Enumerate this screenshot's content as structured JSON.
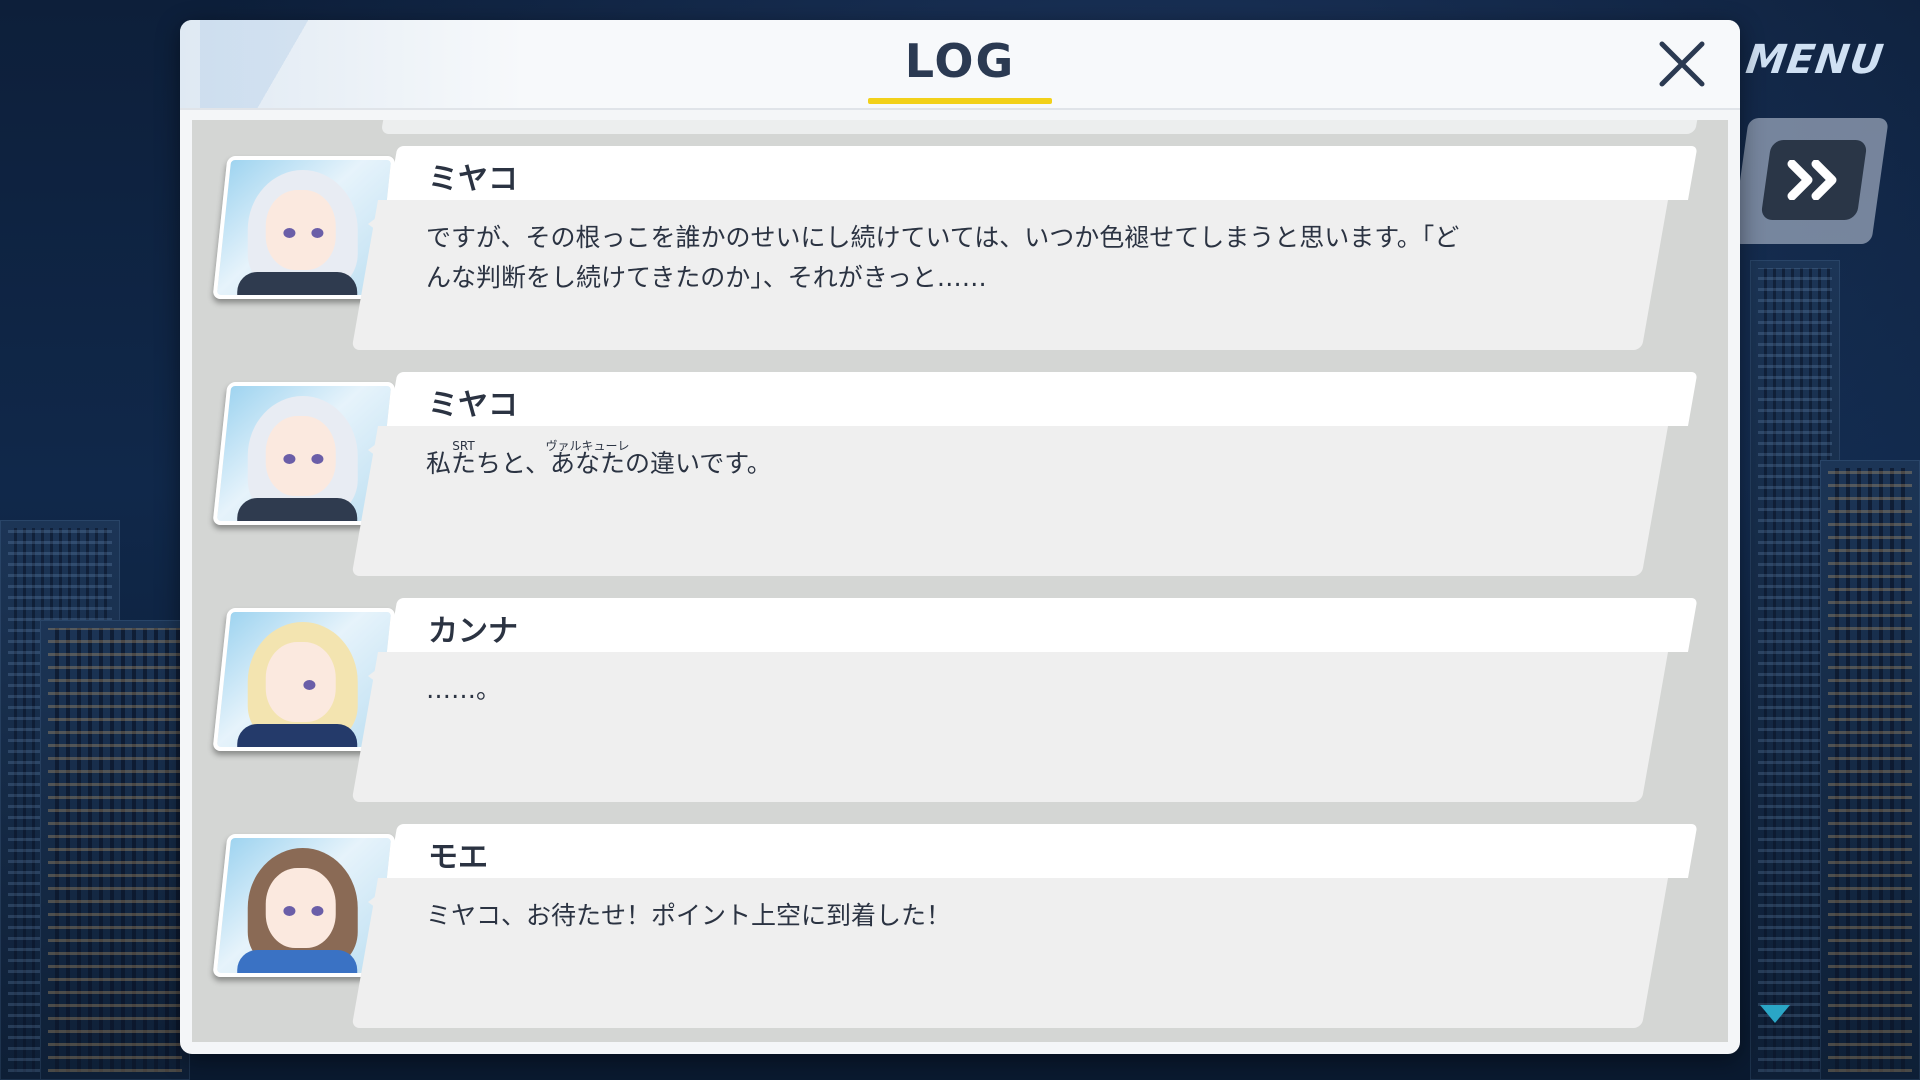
{
  "window": {
    "title": "LOG"
  },
  "controls": {
    "menu_label": "MENU",
    "skip_icon": "double-chevron-right-icon",
    "close_icon": "close-icon",
    "scroll_icon": "triangle-down-icon"
  },
  "colors": {
    "accent_underline": "#f2d11a",
    "title_text": "#2b3a52",
    "scroll_arrow": "#2aa6c6"
  },
  "log": {
    "entries": [
      {
        "speaker": "ミヤコ",
        "avatar": "miyako-avatar",
        "line1": "ですが、その根っこを誰かのせいにし続けていては、いつか色褪せてしまうと思います。「ど",
        "line2": "んな判断をし続けてきたのか」、それがきっと……"
      },
      {
        "speaker": "ミヤコ",
        "avatar": "miyako-avatar",
        "ruby1_base": "私たち",
        "ruby1_text": "SRT",
        "mid": "と、",
        "ruby2_base": "あなた",
        "ruby2_text": "ヴァルキューレ",
        "tail": "の違いです。"
      },
      {
        "speaker": "カンナ",
        "avatar": "kanna-avatar",
        "text": "……。"
      },
      {
        "speaker": "モエ",
        "avatar": "moe-avatar",
        "text": "ミヤコ、お待たせ！ポイント上空に到着した！"
      }
    ]
  }
}
